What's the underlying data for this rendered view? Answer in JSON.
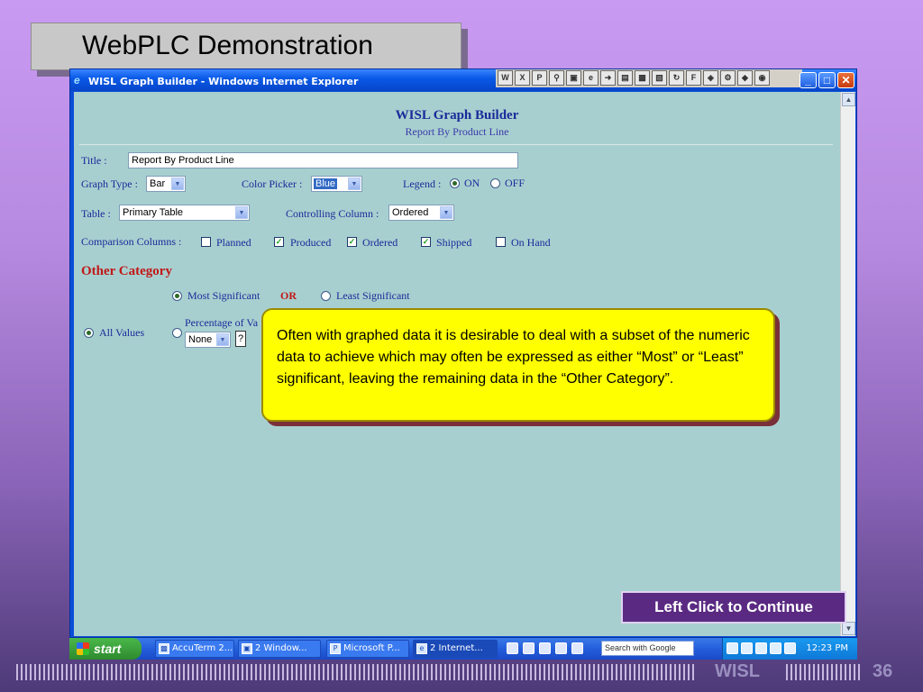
{
  "slide": {
    "title": "WebPLC Demonstration",
    "continue_label": "Left Click to Continue",
    "footer_brand": "WISL",
    "page_number": "36"
  },
  "window": {
    "title": "WISL Graph Builder - Windows Internet Explorer"
  },
  "app": {
    "heading": "WISL Graph Builder",
    "subheading": "Report By Product Line",
    "title_label": "Title :",
    "title_value": "Report By Product Line",
    "graph_type_label": "Graph Type :",
    "graph_type_value": "Bar",
    "color_picker_label": "Color Picker :",
    "color_picker_value": "Blue",
    "legend_label": "Legend :",
    "legend_on": "ON",
    "legend_off": "OFF",
    "table_label": "Table :",
    "table_value": "Primary Table",
    "controlling_column_label": "Controlling Column :",
    "controlling_column_value": "Ordered",
    "comparison_label": "Comparison Columns :",
    "comparison_columns": [
      {
        "label": "Planned",
        "checked": false
      },
      {
        "label": "Produced",
        "checked": true
      },
      {
        "label": "Ordered",
        "checked": true
      },
      {
        "label": "Shipped",
        "checked": true
      },
      {
        "label": "On Hand",
        "checked": false
      }
    ],
    "other_category_heading": "Other Category",
    "most_significant": "Most Significant",
    "or_text": "OR",
    "least_significant": "Least Significant",
    "all_values": "All Values",
    "percentage_of_values": "Percentage of Va",
    "percentage_value": "None",
    "help_label": "?"
  },
  "callout": {
    "text": "Often with graphed data it is desirable to deal with a subset of the numeric data to achieve which may often be expressed as either “Most” or “Least” significant, leaving the remaining data in the “Other Category”."
  },
  "taskbar": {
    "start_label": "start",
    "items": [
      {
        "label": "AccuTerm 2..."
      },
      {
        "label": "2 Window..."
      },
      {
        "label": "Microsoft P..."
      },
      {
        "label": "2 Internet..."
      }
    ],
    "search_placeholder": "Search with Google",
    "clock": "12:23 PM"
  }
}
